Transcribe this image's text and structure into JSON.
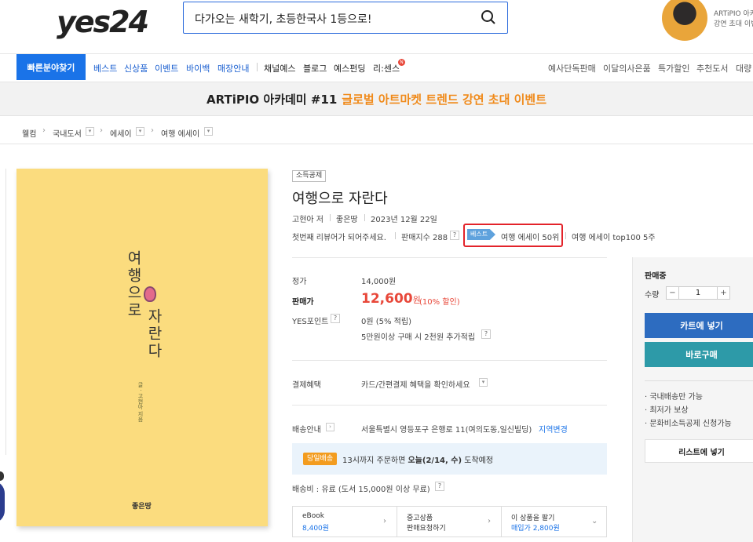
{
  "header": {
    "logo": "yes24",
    "search_value": "다가오는 새학기, 초등한국사 1등으로!",
    "ad_text_line1": "ARTiPIO 아카",
    "ad_text_line2": "강연 초대 이벤"
  },
  "nav": {
    "quick_find": "빠른분야찾기",
    "items_blue": [
      "베스트",
      "신상품",
      "이벤트",
      "바이백",
      "매장안내"
    ],
    "items_dark": [
      "채널예스",
      "블로그",
      "예스펀딩",
      "리:센스"
    ],
    "new_badge": "N",
    "items_right": [
      "예사단독판매",
      "이달의사은품",
      "특가할인",
      "추천도서",
      "대량"
    ]
  },
  "banner": {
    "main": "ARTiPIO 아카데미 #11",
    "highlight": "글로벌 아트마켓 트렌드 강연 초대 이벤트"
  },
  "breadcrumb": {
    "home": "웰컴",
    "items": [
      "국내도서",
      "에세이",
      "여행 에세이"
    ]
  },
  "cover": {
    "title_part1": "여행으로",
    "title_part2": "자란다",
    "author": "글 · 고현아 지음",
    "publisher": "좋은땅"
  },
  "product": {
    "tag": "소득공제",
    "title": "여행으로 자란다",
    "author": "고현아 저",
    "publisher": "좋은땅",
    "date": "2023년 12월 22일",
    "first_reviewer": "첫번째 리뷰어가 되어주세요.",
    "sales_index": "판매지수 288",
    "best_tag": "베스트",
    "best_rank": "여행 에세이 50위",
    "top100": "여행 에세이 top100 5주"
  },
  "price": {
    "list_label": "정가",
    "list_value": "14,000원",
    "sale_label": "판매가",
    "sale_value": "12,600",
    "sale_unit": "원",
    "discount": "(10% 할인)",
    "points_label": "YES포인트",
    "points_value": "0원 (5% 적립)",
    "points_extra": "5만원이상 구매 시 2천원 추가적립"
  },
  "payment": {
    "label": "결제혜택",
    "value": "카드/간편결제 혜택을 확인하세요"
  },
  "delivery": {
    "label": "배송안내",
    "address": "서울특별시 영등포구 은행로 11(여의도동,일신빌딩)",
    "region_change": "지역변경",
    "today_tag": "당일배송",
    "today_text_pre": "13시까지 주문하면 ",
    "today_text_bold": "오늘(2/14, 수)",
    "today_text_post": " 도착예정",
    "fee": "배송비 : 유료 (도서 15,000원 이상 무료)"
  },
  "sub_cards": [
    {
      "title": "eBook",
      "value": "8,400원"
    },
    {
      "title": "중고상품",
      "value": "판매요청하기"
    },
    {
      "title": "이 상품을 팔기",
      "value": "매입가 2,800원"
    }
  ],
  "side_panel": {
    "status": "판매중",
    "qty_label": "수량",
    "qty_value": "1",
    "minus": "−",
    "plus": "+",
    "cart_button": "카트에 넣기",
    "buy_button": "바로구매",
    "notes": [
      "· 국내배송만 가능",
      "· 최저가 보상",
      "· 문화비소득공제 신청가능"
    ],
    "list_button": "리스트에 넣기"
  },
  "colors": {
    "brand_blue": "#1a73e8",
    "price_red": "#e8483a",
    "highlight_orange": "#f08a1a",
    "cart_blue": "#2d6cc0",
    "buy_teal": "#2d9aa8",
    "best_outline": "#e3232a"
  }
}
